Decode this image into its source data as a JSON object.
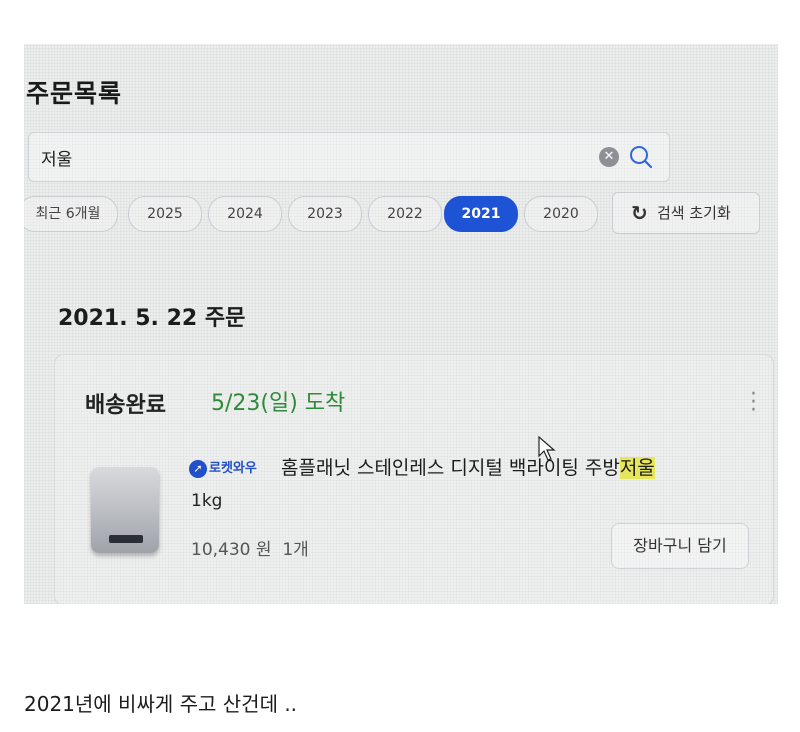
{
  "page_title": "주문목록",
  "search": {
    "value": "저울",
    "clear_icon": "clear-icon",
    "search_icon": "search-icon"
  },
  "year_filters": [
    "최근 6개월",
    "2025",
    "2024",
    "2023",
    "2022",
    "2021",
    "2020"
  ],
  "selected_year": "2021",
  "reset": {
    "label": "검색 초기화",
    "icon": "refresh-icon"
  },
  "order": {
    "date_label": "2021. 5. 22 주문",
    "status": "배송완료",
    "arrival": "5/23(일) 도착",
    "badge": "로켓와우",
    "product_name_prefix": "홈플래닛 스테인레스 디지털 백라이팅 주방",
    "product_name_highlight": "저울",
    "product_weight": "1kg",
    "price": "10,430 원",
    "quantity": "1개",
    "cart_button": "장바구니 담기"
  },
  "colors": {
    "accent": "#1f53d6",
    "arrival": "#2f8a3a",
    "highlight": "#e6e65a"
  },
  "caption": "2021년에 비싸게 주고 산건데 .."
}
